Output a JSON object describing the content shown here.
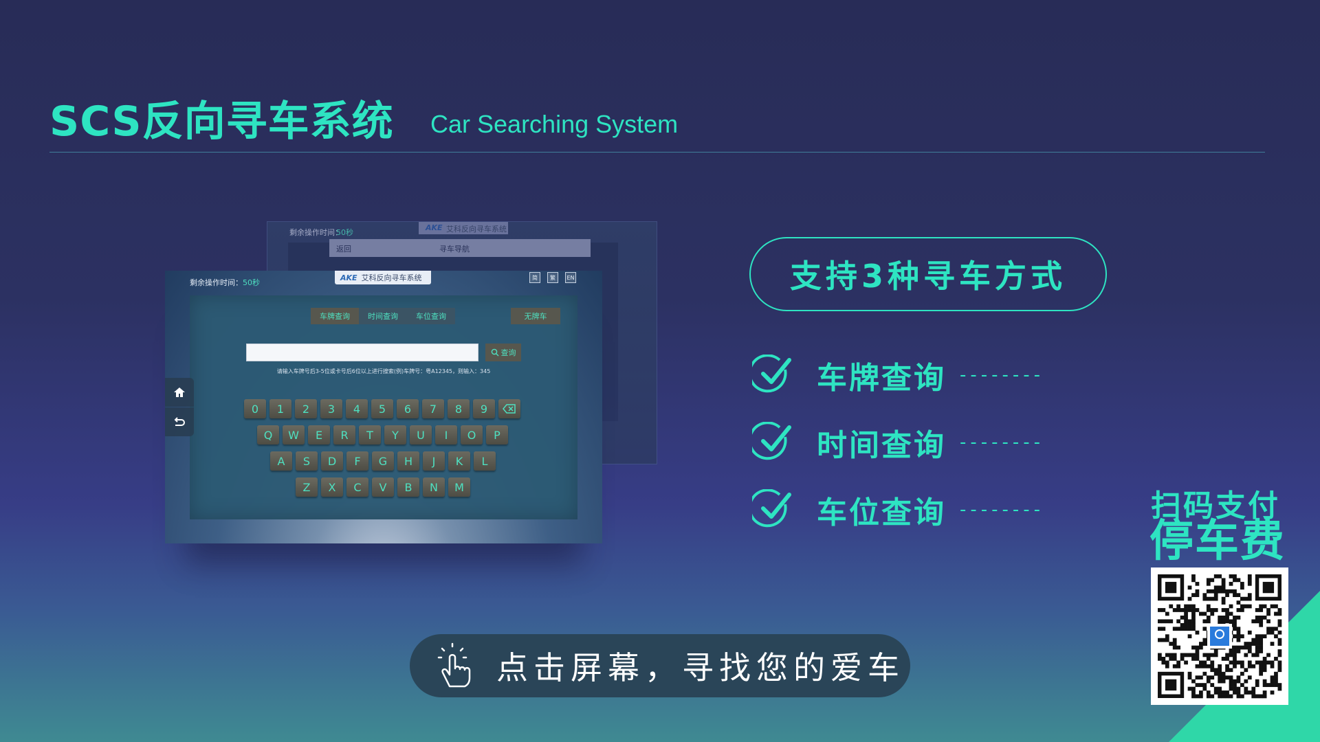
{
  "header": {
    "title_zh": "SCS反向寻车系统",
    "title_en": "Car Searching System"
  },
  "back_screen": {
    "timer_label": "剩余操作时间：",
    "timer_value": "50秒",
    "brand_logo": "AKE",
    "brand_name": "艾科反向寻车系统",
    "back_label": "返回",
    "nav_title": "寻车导航"
  },
  "kiosk": {
    "timer_label": "剩余操作时间：",
    "timer_value": "50秒",
    "brand_logo": "AKE",
    "brand_name": "艾科反向寻车系统",
    "lang_buttons": [
      "简",
      "繁",
      "EN"
    ],
    "tabs": [
      "车牌查询",
      "时间查询",
      "车位查询"
    ],
    "no_plate_button": "无牌车",
    "search_button": "查询",
    "search_value": "",
    "hint": "请输入车牌号后3-5位或卡号后6位以上进行搜索(例)车牌号：粤A12345，则输入：345",
    "keyboard": {
      "row1": [
        "0",
        "1",
        "2",
        "3",
        "4",
        "5",
        "6",
        "7",
        "8",
        "9"
      ],
      "row2": [
        "Q",
        "W",
        "E",
        "R",
        "T",
        "Y",
        "U",
        "I",
        "O",
        "P"
      ],
      "row3": [
        "A",
        "S",
        "D",
        "F",
        "G",
        "H",
        "J",
        "K",
        "L"
      ],
      "row4": [
        "Z",
        "X",
        "C",
        "V",
        "B",
        "N",
        "M"
      ]
    },
    "side_icons": [
      "home-icon",
      "return-icon"
    ]
  },
  "features": {
    "headline": "支持3种寻车方式",
    "items": [
      "车牌查询",
      "时间查询",
      "车位查询"
    ],
    "dash": "--------"
  },
  "cta": {
    "text": "点击屏幕，寻找您的爱车"
  },
  "payment": {
    "line1": "扫码支付",
    "line2": "停车费"
  },
  "colors": {
    "accent": "#2ee4c2",
    "background_top": "#282c57",
    "background_bottom": "#3f8a92"
  }
}
